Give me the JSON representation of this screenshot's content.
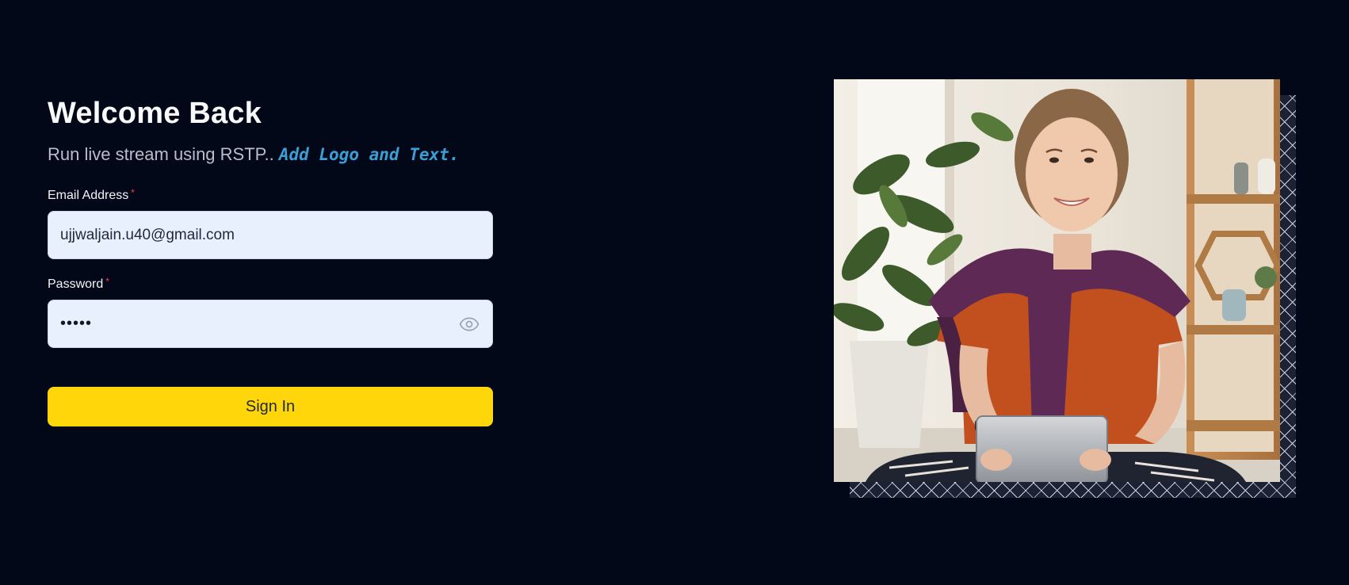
{
  "login": {
    "title": "Welcome Back",
    "subtitle": "Run live stream using RSTP..",
    "subtitle_accent": "Add Logo and Text.",
    "email": {
      "label": "Email Address",
      "required_mark": "*",
      "value": "ujjwaljain.u40@gmail.com"
    },
    "password": {
      "label": "Password",
      "required_mark": "*",
      "masked_value": "•••••",
      "toggle_icon": "eye-icon"
    },
    "submit_label": "Sign In"
  },
  "hero_image": {
    "description_icon": "person-with-tablet-photo"
  },
  "colors": {
    "background": "#020817",
    "accent_link": "#3b9fd6",
    "button": "#ffd60a",
    "input_bg": "#e8f0fe",
    "required": "#ef4444"
  }
}
